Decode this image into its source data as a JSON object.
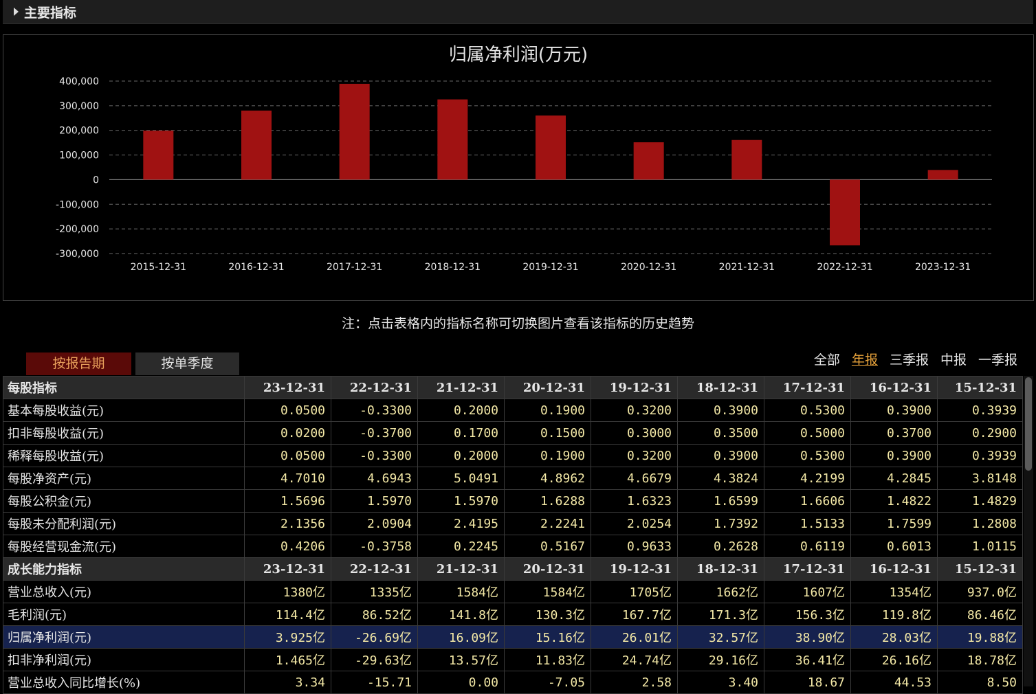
{
  "section": {
    "title": "主要指标",
    "icon": "caret-right-icon"
  },
  "chart_data": {
    "type": "bar",
    "title": "归属净利润(万元)",
    "categories": [
      "2015-12-31",
      "2016-12-31",
      "2017-12-31",
      "2018-12-31",
      "2019-12-31",
      "2020-12-31",
      "2021-12-31",
      "2022-12-31",
      "2023-12-31"
    ],
    "values": [
      198800,
      280300,
      389000,
      325700,
      260100,
      151600,
      160900,
      -266900,
      39250
    ],
    "ylim": [
      -300000,
      400000
    ],
    "yticks": [
      400000,
      300000,
      200000,
      100000,
      0,
      -100000,
      -200000,
      -300000
    ],
    "ytick_labels": [
      "400,000",
      "300,000",
      "200,000",
      "100,000",
      "0",
      "-100,000",
      "-200,000",
      "-300,000"
    ],
    "grid": true,
    "bar_color": "#a01212"
  },
  "note": "注：点击表格内的指标名称可切换图片查看该指标的历史趋势",
  "tabs": [
    {
      "label": "按报告期",
      "active": true
    },
    {
      "label": "按单季度",
      "active": false
    }
  ],
  "filters": [
    {
      "label": "全部",
      "selected": false
    },
    {
      "label": "年报",
      "selected": true
    },
    {
      "label": "三季报",
      "selected": false
    },
    {
      "label": "中报",
      "selected": false
    },
    {
      "label": "一季报",
      "selected": false
    }
  ],
  "table": {
    "rows": [
      {
        "type": "header",
        "label": "每股指标",
        "values": [
          "23-12-31",
          "22-12-31",
          "21-12-31",
          "20-12-31",
          "19-12-31",
          "18-12-31",
          "17-12-31",
          "16-12-31",
          "15-12-31"
        ]
      },
      {
        "type": "data",
        "label": "基本每股收益(元)",
        "values": [
          "0.0500",
          "-0.3300",
          "0.2000",
          "0.1900",
          "0.3200",
          "0.3900",
          "0.5300",
          "0.3900",
          "0.3939"
        ]
      },
      {
        "type": "data",
        "label": "扣非每股收益(元)",
        "values": [
          "0.0200",
          "-0.3700",
          "0.1700",
          "0.1500",
          "0.3000",
          "0.3500",
          "0.5000",
          "0.3700",
          "0.2900"
        ]
      },
      {
        "type": "data",
        "label": "稀释每股收益(元)",
        "values": [
          "0.0500",
          "-0.3300",
          "0.2000",
          "0.1900",
          "0.3200",
          "0.3900",
          "0.5300",
          "0.3900",
          "0.3939"
        ]
      },
      {
        "type": "data",
        "label": "每股净资产(元)",
        "values": [
          "4.7010",
          "4.6943",
          "5.0491",
          "4.8962",
          "4.6679",
          "4.3824",
          "4.2199",
          "4.2845",
          "3.8148"
        ]
      },
      {
        "type": "data",
        "label": "每股公积金(元)",
        "values": [
          "1.5696",
          "1.5970",
          "1.5970",
          "1.6288",
          "1.6323",
          "1.6599",
          "1.6606",
          "1.4822",
          "1.4829"
        ]
      },
      {
        "type": "data",
        "label": "每股未分配利润(元)",
        "values": [
          "2.1356",
          "2.0904",
          "2.4195",
          "2.2241",
          "2.0254",
          "1.7392",
          "1.5133",
          "1.7599",
          "1.2808"
        ]
      },
      {
        "type": "data",
        "label": "每股经营现金流(元)",
        "values": [
          "0.4206",
          "-0.3758",
          "0.2245",
          "0.5167",
          "0.9633",
          "0.2628",
          "0.6119",
          "0.6013",
          "1.0115"
        ]
      },
      {
        "type": "header",
        "label": "成长能力指标",
        "values": [
          "23-12-31",
          "22-12-31",
          "21-12-31",
          "20-12-31",
          "19-12-31",
          "18-12-31",
          "17-12-31",
          "16-12-31",
          "15-12-31"
        ]
      },
      {
        "type": "data",
        "label": "营业总收入(元)",
        "values": [
          "1380亿",
          "1335亿",
          "1584亿",
          "1584亿",
          "1705亿",
          "1662亿",
          "1607亿",
          "1354亿",
          "937.0亿"
        ]
      },
      {
        "type": "data",
        "label": "毛利润(元)",
        "values": [
          "114.4亿",
          "86.52亿",
          "141.8亿",
          "130.3亿",
          "167.7亿",
          "171.3亿",
          "156.3亿",
          "119.8亿",
          "86.46亿"
        ]
      },
      {
        "type": "highlight",
        "label": "归属净利润(元)",
        "values": [
          "3.925亿",
          "-26.69亿",
          "16.09亿",
          "15.16亿",
          "26.01亿",
          "32.57亿",
          "38.90亿",
          "28.03亿",
          "19.88亿"
        ]
      },
      {
        "type": "data",
        "label": "扣非净利润(元)",
        "values": [
          "1.465亿",
          "-29.63亿",
          "13.57亿",
          "11.83亿",
          "24.74亿",
          "29.16亿",
          "36.41亿",
          "26.16亿",
          "18.78亿"
        ]
      },
      {
        "type": "data",
        "label": "营业总收入同比增长(%)",
        "values": [
          "3.34",
          "-15.71",
          "0.00",
          "-7.05",
          "2.58",
          "3.40",
          "18.67",
          "44.53",
          "8.50"
        ]
      }
    ]
  }
}
